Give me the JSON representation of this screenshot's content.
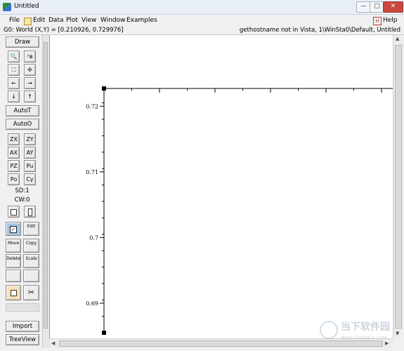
{
  "window": {
    "title": "Untitled",
    "min_glyph": "—",
    "max_glyph": "▢",
    "close_glyph": "✕"
  },
  "menu": {
    "items": [
      "File",
      "Edit",
      "Data",
      "Plot",
      "View",
      "Window",
      "Examples"
    ],
    "help": "Help"
  },
  "status": {
    "left": "G0: World (X,Y) = [0.210926, 0.729976]",
    "right": "gethostname not in Vista, 1\\WinSta0\\Default, Untitled"
  },
  "toolbar": {
    "draw": "Draw",
    "zoom_glyph": "🔍",
    "text_glyph": "ᴬʙ",
    "expand_glyph": "⛶",
    "shrink_glyph": "✣",
    "left_glyph": "←",
    "right_glyph": "→",
    "down_glyph": "↓",
    "up_glyph": "↑",
    "autot": "AutoT",
    "autoo": "AutoO",
    "zx": "ZX",
    "zy": "ZY",
    "ax": "AX",
    "ay": "AY",
    "pz": "PZ",
    "pu": "Pu",
    "po": "Po",
    "cy": "Cy",
    "sd": "SD:1",
    "cw": "CW:0",
    "edit_label": "Edit",
    "move_label": "Move",
    "copy_label": "Copy",
    "delete_label": "Delete",
    "scale_label": "Scale",
    "import": "Import",
    "treeview": "TreeView"
  },
  "chart_data": {
    "type": "line",
    "series": [],
    "y_ticks": [
      "0.72",
      "0.71",
      "0.7",
      "0.69"
    ],
    "y_tick_values": [
      0.72,
      0.71,
      0.7,
      0.69
    ],
    "ylim": [
      0.6855,
      0.7227
    ],
    "x_tick_labels_clipped": true,
    "grid": false
  },
  "watermark": {
    "text_cn": "当下软件园",
    "url": "www.downxia.com"
  }
}
